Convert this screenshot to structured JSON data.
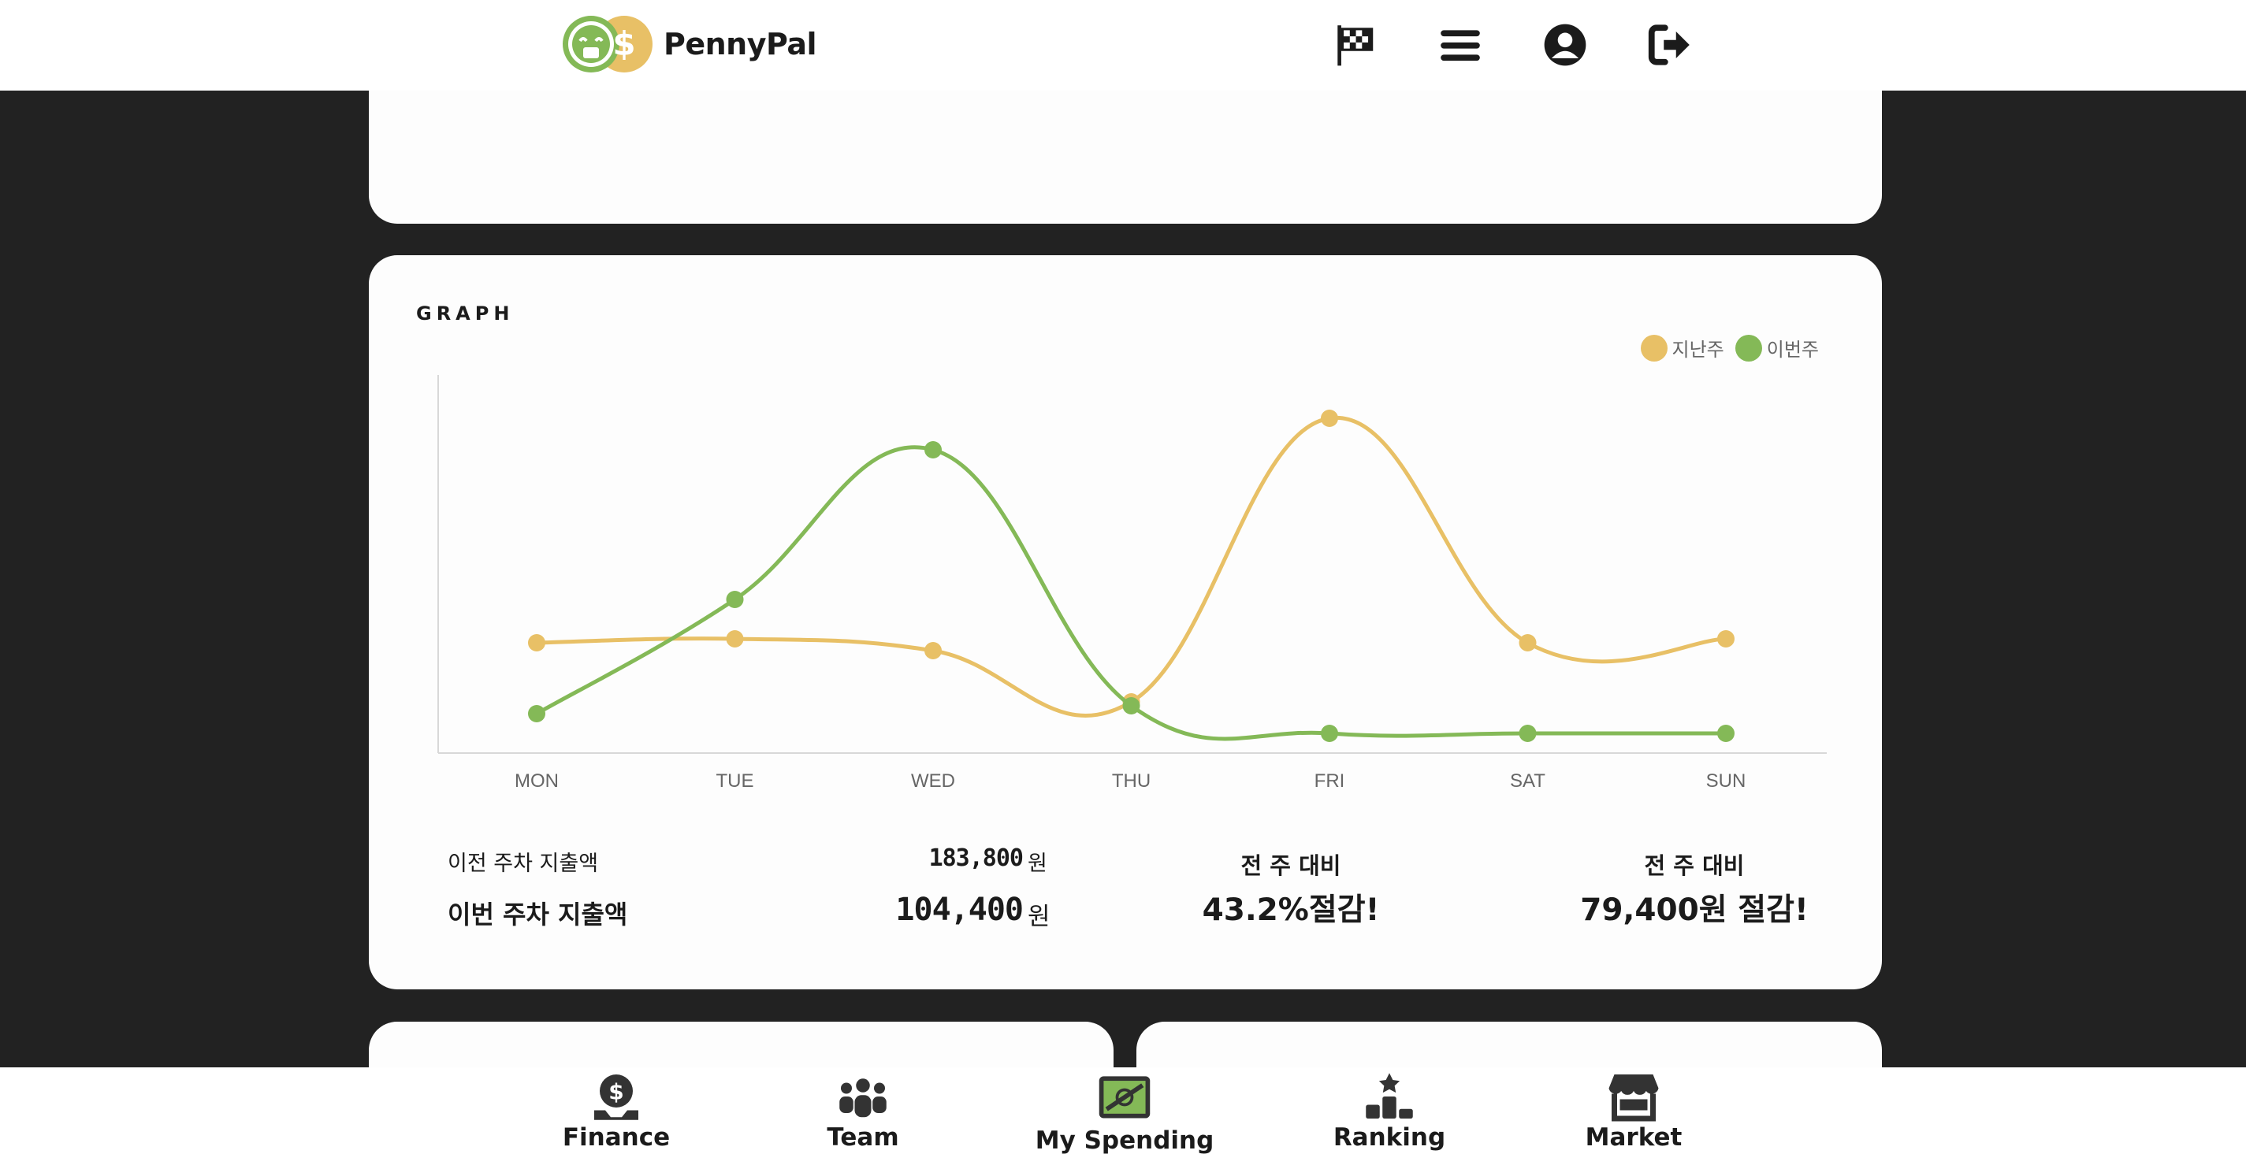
{
  "header": {
    "brand": "PennyPal",
    "icons": [
      "flag-checkered-icon",
      "menu-icon",
      "user-circle-icon",
      "logout-icon"
    ]
  },
  "graph_card": {
    "title": "GRAPH",
    "legend": [
      {
        "label": "지난주",
        "color": "#e8c066"
      },
      {
        "label": "이번주",
        "color": "#84b957"
      }
    ]
  },
  "chart_data": {
    "type": "line",
    "categories": [
      "MON",
      "TUE",
      "WED",
      "THU",
      "FRI",
      "SAT",
      "SUN"
    ],
    "series": [
      {
        "name": "지난주",
        "color": "#e8c066",
        "values": [
          18,
          19,
          16,
          3,
          75,
          18,
          19
        ]
      },
      {
        "name": "이번주",
        "color": "#84b957",
        "values": [
          0,
          29,
          67,
          2,
          -5,
          -5,
          -5
        ]
      }
    ],
    "ylim": [
      -10,
      86
    ],
    "grid": false,
    "legend_position": "top-right",
    "smooth": true
  },
  "stats": {
    "prev_label": "이전 주차 지출액",
    "prev_value": "183,800",
    "prev_unit": "원",
    "this_label": "이번 주차 지출액",
    "this_value": "104,400",
    "this_unit": "원"
  },
  "compare": [
    {
      "head": "전 주 대비",
      "value": "43.2%절감!"
    },
    {
      "head": "전 주 대비",
      "value": "79,400원 절감!"
    }
  ],
  "bottom_nav": [
    {
      "label": "Finance",
      "icon": "dollar-coin-icon"
    },
    {
      "label": "Team",
      "icon": "team-icon"
    },
    {
      "label": "My Spending",
      "icon": "money-icon"
    },
    {
      "label": "Ranking",
      "icon": "podium-icon"
    },
    {
      "label": "Market",
      "icon": "store-icon"
    }
  ],
  "colors": {
    "accent_green": "#84b957",
    "accent_yellow": "#e8c066",
    "background": "#222222",
    "card": "#fdfdfd"
  }
}
